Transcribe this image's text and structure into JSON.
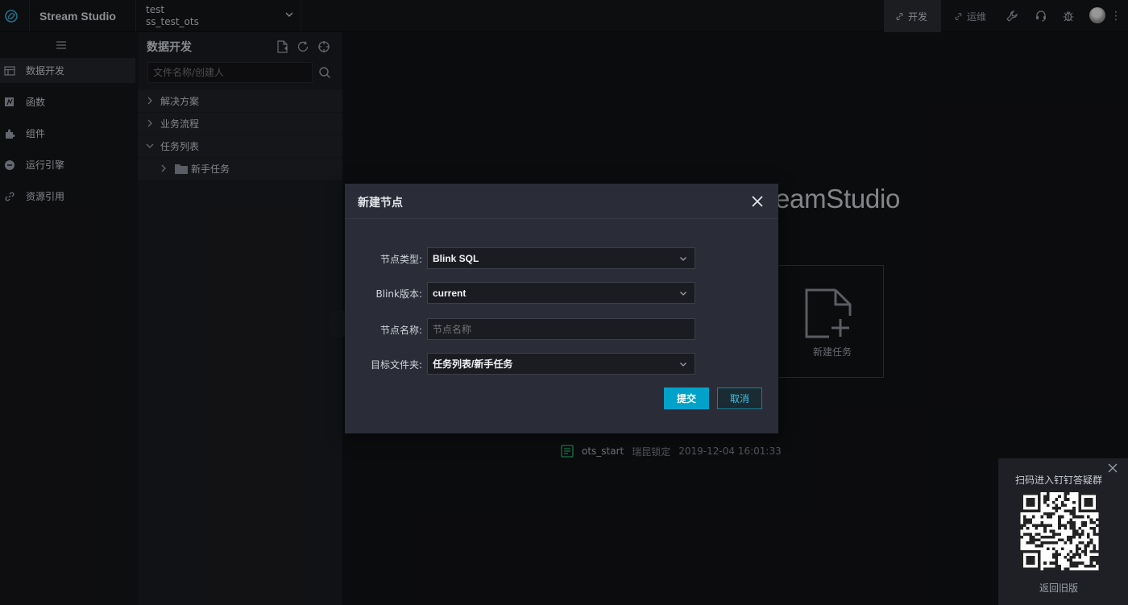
{
  "topbar": {
    "brand": "Stream Studio",
    "project_line1": "test",
    "project_line2": "ss_test_ots",
    "nav_dev": "开发",
    "nav_ops": "运维"
  },
  "leftnav": {
    "items": [
      {
        "label": "数据开发",
        "icon": "table-icon",
        "active": true
      },
      {
        "label": "函数",
        "icon": "function-icon",
        "active": false
      },
      {
        "label": "组件",
        "icon": "puzzle-icon",
        "active": false
      },
      {
        "label": "运行引擎",
        "icon": "engine-icon",
        "active": false
      },
      {
        "label": "资源引用",
        "icon": "link-icon",
        "active": false
      }
    ]
  },
  "panel": {
    "title": "数据开发",
    "search_placeholder": "文件名称/创建人",
    "tree": [
      {
        "label": "解决方案",
        "expanded": false
      },
      {
        "label": "业务流程",
        "expanded": false
      },
      {
        "label": "任务列表",
        "expanded": true
      }
    ],
    "tree_child": "新手任务"
  },
  "main": {
    "welcome": "eamStudio",
    "new_task_label": "新建任务",
    "recent": {
      "file": "ots_start",
      "owner": "瑞昆锁定",
      "time": "2019-12-04 16:01:33"
    }
  },
  "modal": {
    "title": "新建节点",
    "node_type_label": "节点类型:",
    "node_type_value": "Blink SQL",
    "blink_version_label": "Blink版本:",
    "blink_version_value": "current",
    "node_name_label": "节点名称:",
    "node_name_placeholder": "节点名称",
    "target_folder_label": "目标文件夹:",
    "target_folder_value": "任务列表/新手任务",
    "submit": "提交",
    "cancel": "取消"
  },
  "qr": {
    "title": "扫码进入钉钉答疑群",
    "back": "返回旧版"
  },
  "colors": {
    "accent": "#00a2ca",
    "background": "#121316",
    "modal": "#2a2d38"
  }
}
